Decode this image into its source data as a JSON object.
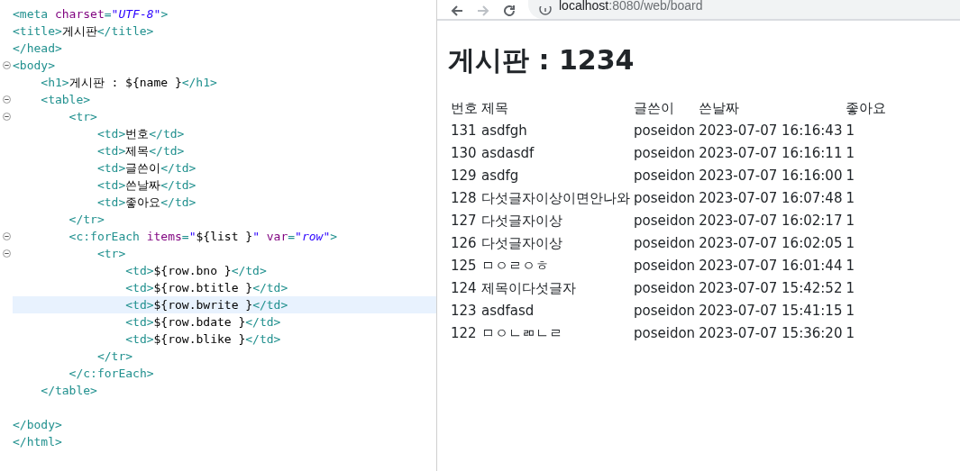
{
  "editor": {
    "lines": [
      {
        "kind": "code",
        "fold": false,
        "current": false,
        "tokens": [
          {
            "kind": "tag",
            "text": "<meta "
          },
          {
            "kind": "attr",
            "text": "charset"
          },
          {
            "kind": "tag",
            "text": "="
          },
          {
            "kind": "value",
            "text": "\"UTF-8\""
          },
          {
            "kind": "tag",
            "text": ">"
          }
        ]
      },
      {
        "kind": "code",
        "fold": false,
        "current": false,
        "tokens": [
          {
            "kind": "tag",
            "text": "<title>"
          },
          {
            "kind": "text",
            "text": "게시판"
          },
          {
            "kind": "tag",
            "text": "</title>"
          }
        ]
      },
      {
        "kind": "code",
        "fold": false,
        "current": false,
        "tokens": [
          {
            "kind": "tag",
            "text": "</head>"
          }
        ]
      },
      {
        "kind": "code",
        "fold": true,
        "current": false,
        "tokens": [
          {
            "kind": "tag",
            "text": "<body>"
          }
        ]
      },
      {
        "kind": "code",
        "fold": false,
        "current": false,
        "tokens": [
          {
            "kind": "tag",
            "text": "    <h1>"
          },
          {
            "kind": "text",
            "text": "게시판 : ${name }"
          },
          {
            "kind": "tag",
            "text": "</h1>"
          }
        ]
      },
      {
        "kind": "code",
        "fold": true,
        "current": false,
        "tokens": [
          {
            "kind": "tag",
            "text": "    <table>"
          }
        ]
      },
      {
        "kind": "code",
        "fold": true,
        "current": false,
        "tokens": [
          {
            "kind": "tag",
            "text": "        <tr>"
          }
        ]
      },
      {
        "kind": "code",
        "fold": false,
        "current": false,
        "tokens": [
          {
            "kind": "tag",
            "text": "            <td>"
          },
          {
            "kind": "text",
            "text": "번호"
          },
          {
            "kind": "tag",
            "text": "</td>"
          }
        ]
      },
      {
        "kind": "code",
        "fold": false,
        "current": false,
        "tokens": [
          {
            "kind": "tag",
            "text": "            <td>"
          },
          {
            "kind": "text",
            "text": "제목"
          },
          {
            "kind": "tag",
            "text": "</td>"
          }
        ]
      },
      {
        "kind": "code",
        "fold": false,
        "current": false,
        "tokens": [
          {
            "kind": "tag",
            "text": "            <td>"
          },
          {
            "kind": "text",
            "text": "글쓴이"
          },
          {
            "kind": "tag",
            "text": "</td>"
          }
        ]
      },
      {
        "kind": "code",
        "fold": false,
        "current": false,
        "tokens": [
          {
            "kind": "tag",
            "text": "            <td>"
          },
          {
            "kind": "text",
            "text": "쓴날짜"
          },
          {
            "kind": "tag",
            "text": "</td>"
          }
        ]
      },
      {
        "kind": "code",
        "fold": false,
        "current": false,
        "tokens": [
          {
            "kind": "tag",
            "text": "            <td>"
          },
          {
            "kind": "text",
            "text": "좋아요"
          },
          {
            "kind": "tag",
            "text": "</td>"
          }
        ]
      },
      {
        "kind": "code",
        "fold": false,
        "current": false,
        "tokens": [
          {
            "kind": "tag",
            "text": "        </tr>"
          }
        ]
      },
      {
        "kind": "code",
        "fold": true,
        "current": false,
        "tokens": [
          {
            "kind": "tag",
            "text": "        <c:forEach "
          },
          {
            "kind": "attr",
            "text": "items"
          },
          {
            "kind": "tag",
            "text": "="
          },
          {
            "kind": "value",
            "text": "\""
          },
          {
            "kind": "text",
            "text": "${list }"
          },
          {
            "kind": "value",
            "text": "\" "
          },
          {
            "kind": "attr",
            "text": "var"
          },
          {
            "kind": "tag",
            "text": "="
          },
          {
            "kind": "value",
            "text": "\"row\""
          },
          {
            "kind": "tag",
            "text": ">"
          }
        ]
      },
      {
        "kind": "code",
        "fold": true,
        "current": false,
        "tokens": [
          {
            "kind": "tag",
            "text": "            <tr>"
          }
        ]
      },
      {
        "kind": "code",
        "fold": false,
        "current": false,
        "tokens": [
          {
            "kind": "tag",
            "text": "                <td>"
          },
          {
            "kind": "text",
            "text": "${row.bno }"
          },
          {
            "kind": "tag",
            "text": "</td>"
          }
        ]
      },
      {
        "kind": "code",
        "fold": false,
        "current": false,
        "tokens": [
          {
            "kind": "tag",
            "text": "                <td>"
          },
          {
            "kind": "text",
            "text": "${row.btitle }"
          },
          {
            "kind": "tag",
            "text": "</td>"
          }
        ]
      },
      {
        "kind": "code",
        "fold": false,
        "current": true,
        "tokens": [
          {
            "kind": "tag",
            "text": "                <td>"
          },
          {
            "kind": "text",
            "text": "${row.bwrite }"
          },
          {
            "kind": "tag",
            "text": "</td>"
          }
        ]
      },
      {
        "kind": "code",
        "fold": false,
        "current": false,
        "tokens": [
          {
            "kind": "tag",
            "text": "                <td>"
          },
          {
            "kind": "text",
            "text": "${row.bdate }"
          },
          {
            "kind": "tag",
            "text": "</td>"
          }
        ]
      },
      {
        "kind": "code",
        "fold": false,
        "current": false,
        "tokens": [
          {
            "kind": "tag",
            "text": "                <td>"
          },
          {
            "kind": "text",
            "text": "${row.blike }"
          },
          {
            "kind": "tag",
            "text": "</td>"
          }
        ]
      },
      {
        "kind": "code",
        "fold": false,
        "current": false,
        "tokens": [
          {
            "kind": "tag",
            "text": "            </tr>"
          }
        ]
      },
      {
        "kind": "code",
        "fold": false,
        "current": false,
        "tokens": [
          {
            "kind": "tag",
            "text": "        </c:forEach>"
          }
        ]
      },
      {
        "kind": "code",
        "fold": false,
        "current": false,
        "tokens": [
          {
            "kind": "tag",
            "text": "    </table>"
          }
        ]
      },
      {
        "kind": "blank"
      },
      {
        "kind": "code",
        "fold": false,
        "current": false,
        "tokens": [
          {
            "kind": "tag",
            "text": "</body>"
          }
        ]
      },
      {
        "kind": "code",
        "fold": false,
        "current": false,
        "tokens": [
          {
            "kind": "tag",
            "text": "</html>"
          }
        ]
      }
    ]
  },
  "browser": {
    "forward_disabled": true,
    "address": {
      "host": "localhost",
      "path": ":8080/web/board"
    },
    "page": {
      "heading": "게시판 : 1234",
      "table": {
        "columns": [
          "번호",
          "제목",
          "글쓴이",
          "쓴날짜",
          "좋아요"
        ],
        "rows": [
          [
            "131",
            "asdfgh",
            "poseidon",
            "2023-07-07 16:16:43",
            "1"
          ],
          [
            "130",
            "asdasdf",
            "poseidon",
            "2023-07-07 16:16:11",
            "1"
          ],
          [
            "129",
            "asdfg",
            "poseidon",
            "2023-07-07 16:16:00",
            "1"
          ],
          [
            "128",
            "다섯글자이상이면안나와",
            "poseidon",
            "2023-07-07 16:07:48",
            "1"
          ],
          [
            "127",
            "다섯글자이상",
            "poseidon",
            "2023-07-07 16:02:17",
            "1"
          ],
          [
            "126",
            "다섯글자이상",
            "poseidon",
            "2023-07-07 16:02:05",
            "1"
          ],
          [
            "125",
            "ㅁㅇㄹㅇㅎ",
            "poseidon",
            "2023-07-07 16:01:44",
            "1"
          ],
          [
            "124",
            "제목이다섯글자",
            "poseidon",
            "2023-07-07 15:42:52",
            "1"
          ],
          [
            "123",
            "asdfasd",
            "poseidon",
            "2023-07-07 15:41:15",
            "1"
          ],
          [
            "122",
            "ㅁㅇㄴㄻㄴㄹ",
            "poseidon",
            "2023-07-07 15:36:20",
            "1"
          ]
        ]
      }
    }
  }
}
